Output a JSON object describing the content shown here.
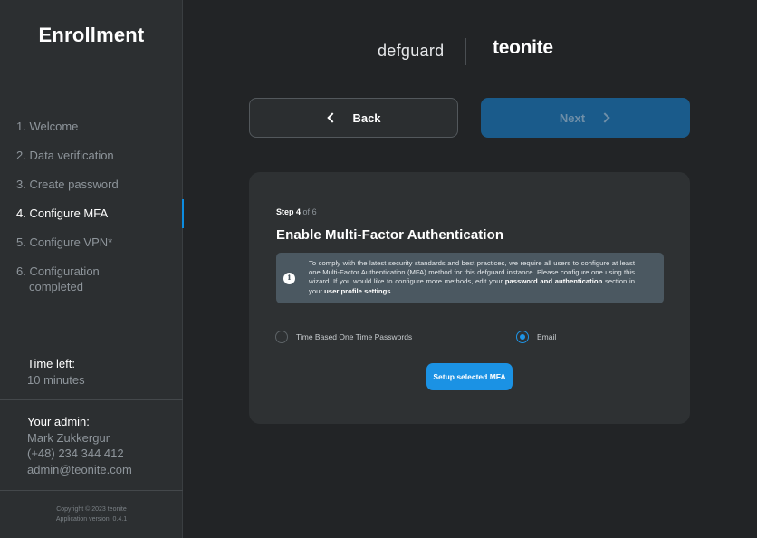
{
  "sidebar": {
    "title": "Enrollment",
    "steps": [
      {
        "label": "1. Welcome"
      },
      {
        "label": "2. Data verification"
      },
      {
        "label": "3. Create password"
      },
      {
        "label": "4. Configure MFA"
      },
      {
        "label": "5. Configure VPN*"
      },
      {
        "label": "6. Configuration",
        "label2": "completed"
      }
    ],
    "active_step": 4,
    "time_left": {
      "label": "Time left:",
      "value": "10 minutes"
    },
    "admin": {
      "label": "Your admin:",
      "name": "Mark Zukkergur",
      "phone": "(+48) 234 344 412",
      "email": "admin@teonite.com"
    },
    "copyright": "Copyright © 2023 teonite",
    "version": "Application version: 0.4.1"
  },
  "header": {
    "logo_left": "defguard",
    "logo_right": "teonite"
  },
  "nav": {
    "back_label": "Back",
    "next_label": "Next"
  },
  "card": {
    "step_prefix": "Step 4",
    "step_of": "of",
    "step_total": "6",
    "title": "Enable Multi-Factor Authentication",
    "info": {
      "icon": "info-icon",
      "text_1": "To comply with the latest security standards and best practices, we require all users to configure at least one Multi-Factor Authentication (MFA) method for this defguard instance. Please configure one using this wizard. If you would like to configure more methods, edit your ",
      "bold_1": "password and authentication",
      "text_2": " section in your ",
      "bold_2": "user profile settings",
      "text_3": "."
    },
    "options": [
      {
        "label": "Time Based One Time Passwords",
        "checked": false
      },
      {
        "label": "Email",
        "checked": true
      }
    ],
    "setup_button": "Setup selected MFA"
  },
  "colors": {
    "accent": "#1b92e4",
    "background": "#222426",
    "sidebar": "#2c2f31",
    "card": "#2e3133",
    "next_button": "#1a5b8b"
  }
}
